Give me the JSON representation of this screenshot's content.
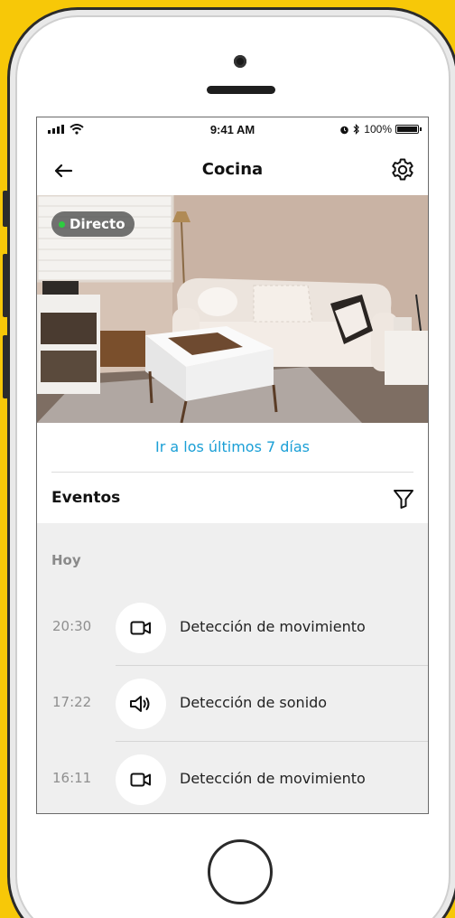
{
  "status_bar": {
    "time": "9:41 AM",
    "battery": "100%"
  },
  "nav": {
    "title": "Cocina"
  },
  "live": {
    "badge": "Directo"
  },
  "links": {
    "last_days": "Ir a los últimos 7 días"
  },
  "events": {
    "title": "Eventos",
    "group_label": "Hoy",
    "items": [
      {
        "time": "20:30",
        "type": "video-camera-icon",
        "label": "Detección de movimiento"
      },
      {
        "time": "17:22",
        "type": "speaker-icon",
        "label": "Detección de sonido"
      },
      {
        "time": "16:11",
        "type": "video-camera-icon",
        "label": "Detección de movimiento"
      }
    ]
  },
  "colors": {
    "background": "#f7c808",
    "link": "#1a9fd6",
    "live_dot": "#2ecc40",
    "events_panel": "#efefef"
  }
}
